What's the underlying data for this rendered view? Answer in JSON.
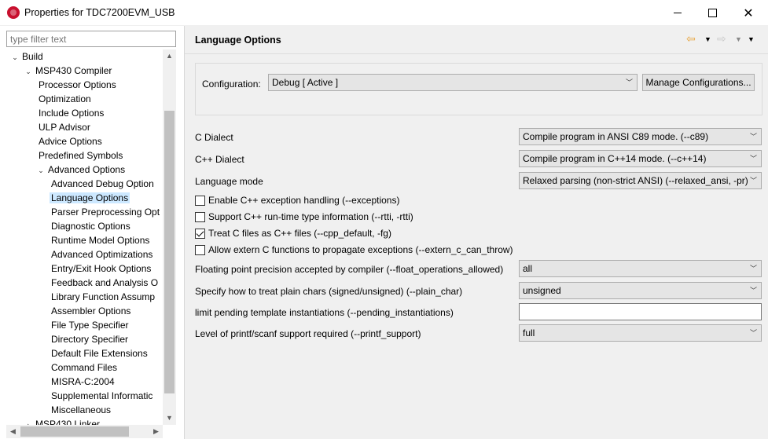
{
  "window": {
    "title": "Properties for TDC7200EVM_USB",
    "minimize_label": "—",
    "maximize_label": "□",
    "close_label": "✕"
  },
  "filter": {
    "placeholder": "type filter text"
  },
  "tree": {
    "items": [
      {
        "label": "Build",
        "level": 0,
        "expanded": true
      },
      {
        "label": "MSP430 Compiler",
        "level": 1,
        "expanded": true
      },
      {
        "label": "Processor Options",
        "level": 2
      },
      {
        "label": "Optimization",
        "level": 2
      },
      {
        "label": "Include Options",
        "level": 2
      },
      {
        "label": "ULP Advisor",
        "level": 2
      },
      {
        "label": "Advice Options",
        "level": 2
      },
      {
        "label": "Predefined Symbols",
        "level": 2
      },
      {
        "label": "Advanced Options",
        "level": 2,
        "expanded": true
      },
      {
        "label": "Advanced Debug Option",
        "level": 3
      },
      {
        "label": "Language Options",
        "level": 3,
        "selected": true
      },
      {
        "label": "Parser Preprocessing Opt",
        "level": 3
      },
      {
        "label": "Diagnostic Options",
        "level": 3
      },
      {
        "label": "Runtime Model Options",
        "level": 3
      },
      {
        "label": "Advanced Optimizations",
        "level": 3
      },
      {
        "label": "Entry/Exit Hook Options",
        "level": 3
      },
      {
        "label": "Feedback and Analysis O",
        "level": 3
      },
      {
        "label": "Library Function Assump",
        "level": 3
      },
      {
        "label": "Assembler Options",
        "level": 3
      },
      {
        "label": "File Type Specifier",
        "level": 3
      },
      {
        "label": "Directory Specifier",
        "level": 3
      },
      {
        "label": "Default File Extensions",
        "level": 3
      },
      {
        "label": "Command Files",
        "level": 3
      },
      {
        "label": "MISRA-C:2004",
        "level": 3
      },
      {
        "label": "Supplemental Informatic",
        "level": 3
      },
      {
        "label": "Miscellaneous",
        "level": 3
      },
      {
        "label": "MSP430 Linker",
        "level": 1,
        "expanded": false
      }
    ]
  },
  "page": {
    "title": "Language Options",
    "configuration_label": "Configuration:",
    "configuration_value": "Debug  [ Active ]",
    "manage_button": "Manage Configurations...",
    "c_dialect_label": "C Dialect",
    "c_dialect_value": "Compile program in ANSI C89 mode. (--c89)",
    "cpp_dialect_label": "C++ Dialect",
    "cpp_dialect_value": "Compile program in C++14 mode. (--c++14)",
    "language_mode_label": "Language mode",
    "language_mode_value": "Relaxed parsing (non-strict ANSI) (--relaxed_ansi, -pr)",
    "checks": {
      "exceptions": {
        "label": "Enable C++ exception handling (--exceptions)",
        "checked": false
      },
      "rtti": {
        "label": "Support C++ run-time type information (--rtti, -rtti)",
        "checked": false
      },
      "cpp_default": {
        "label": "Treat C files as C++ files (--cpp_default, -fg)",
        "checked": true
      },
      "extern_c": {
        "label": "Allow extern C functions to propagate exceptions (--extern_c_can_throw)",
        "checked": false
      }
    },
    "float_label": "Floating point precision accepted by compiler (--float_operations_allowed)",
    "float_value": "all",
    "plain_char_label": "Specify how to treat plain chars (signed/unsigned) (--plain_char)",
    "plain_char_value": "unsigned",
    "pending_label": "limit pending template instantiations (--pending_instantiations)",
    "pending_value": "",
    "printf_label": "Level of printf/scanf support required (--printf_support)",
    "printf_value": "full"
  }
}
